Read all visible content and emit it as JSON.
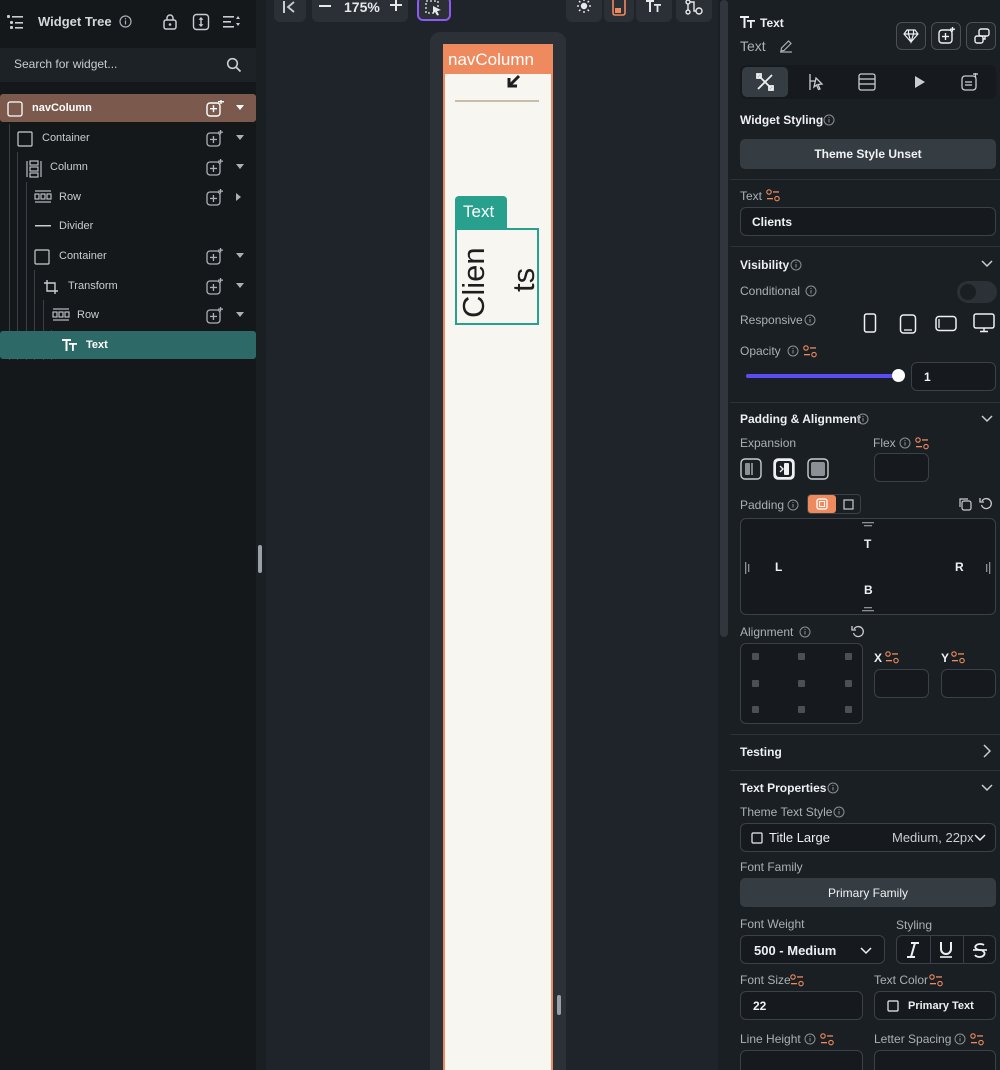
{
  "left": {
    "title": "Widget Tree",
    "search_placeholder": "Search for widget...",
    "tree": [
      {
        "label": "navColumn",
        "icon": "square-icon"
      },
      {
        "label": "Container",
        "icon": "square-icon"
      },
      {
        "label": "Column",
        "icon": "column-icon"
      },
      {
        "label": "Row",
        "icon": "row-icon"
      },
      {
        "label": "Divider",
        "icon": "divider-icon"
      },
      {
        "label": "Container",
        "icon": "square-icon"
      },
      {
        "label": "Transform",
        "icon": "crop-icon"
      },
      {
        "label": "Row",
        "icon": "row-icon"
      },
      {
        "label": "Text",
        "icon": "text-icon"
      }
    ]
  },
  "canvas": {
    "zoom": "175%",
    "nav_tag": "navColumn",
    "text_tag": "Text",
    "rotated_text_line1": "Clien",
    "rotated_text_line2": "ts"
  },
  "right": {
    "widget_type": "Text",
    "widget_name": "Text",
    "widget_styling": {
      "label": "Widget Styling",
      "theme_button": "Theme Style Unset"
    },
    "text": {
      "label": "Text",
      "value": "Clients"
    },
    "visibility": {
      "header": "Visibility",
      "conditional": "Conditional",
      "responsive": "Responsive",
      "opacity": "Opacity",
      "opacity_value": "1",
      "opacity_fraction": 1.0
    },
    "padding_alignment": {
      "header": "Padding & Alignment",
      "expansion": "Expansion",
      "flex": "Flex",
      "padding": "Padding",
      "t": "T",
      "b": "B",
      "l": "L",
      "r": "R",
      "alignment": "Alignment",
      "x": "X",
      "y": "Y"
    },
    "testing": {
      "header": "Testing"
    },
    "text_properties": {
      "header": "Text Properties",
      "theme_text_style": "Theme Text Style",
      "style_name": "Title Large",
      "style_desc": "Medium, 22px",
      "font_family": "Font Family",
      "font_family_value": "Primary Family",
      "font_weight": "Font Weight",
      "font_weight_value": "500 - Medium",
      "styling": "Styling",
      "font_size": "Font Size",
      "font_size_value": "22",
      "text_color": "Text Color",
      "text_color_value": "Primary Text",
      "line_height": "Line Height",
      "letter_spacing": "Letter Spacing"
    }
  },
  "colors": {
    "accent_orange": "#ef8a5f",
    "accent_teal": "#27a08e",
    "slider_purple": "#5b4cf5"
  }
}
